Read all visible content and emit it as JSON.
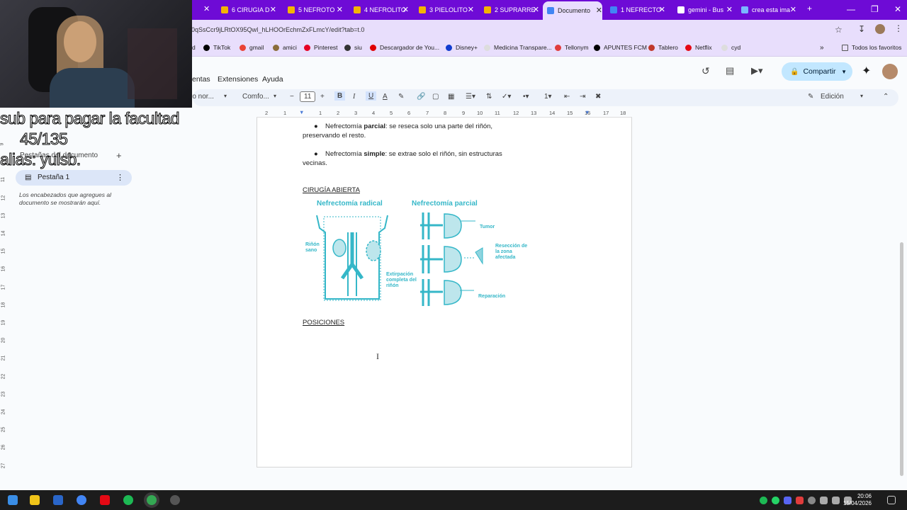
{
  "browser": {
    "tabs": [
      {
        "label": "6 CIRUGIA D",
        "color": "#f4b400"
      },
      {
        "label": "5 NEFROTO",
        "color": "#f4b400"
      },
      {
        "label": "4 NEFROLITO",
        "color": "#f4b400"
      },
      {
        "label": "3 PIELOLITO",
        "color": "#f4b400"
      },
      {
        "label": "2 SUPRARRE",
        "color": "#f4b400"
      },
      {
        "label": "Documento",
        "color": "#4285f4"
      },
      {
        "label": "1 NEFRECTO",
        "color": "#4285f4"
      },
      {
        "label": "gemini - Bus",
        "color": "#ffffff"
      },
      {
        "label": "crea esta ima",
        "color": "#7ab7ff"
      }
    ],
    "new_tab": "+",
    "url": "0qSsCcr9jLRtOX95QwI_hLHOOrEchmZxFLmcY/edit?tab=t.0",
    "bookmarks": [
      {
        "label": "d",
        "color": "#ffffff"
      },
      {
        "label": "TikTok",
        "color": "#000000"
      },
      {
        "label": "gmail",
        "color": "#ea4335"
      },
      {
        "label": "amici",
        "color": "#8a6d3b"
      },
      {
        "label": "Pinterest",
        "color": "#e60023"
      },
      {
        "label": "siu",
        "color": "#333333"
      },
      {
        "label": "Descargador de You...",
        "color": "#e00000"
      },
      {
        "label": "Disney+",
        "color": "#113ccf"
      },
      {
        "label": "Medicina Transpare...",
        "color": "#dddddd"
      },
      {
        "label": "Tellonym",
        "color": "#e03c3c"
      },
      {
        "label": "APUNTES FCM",
        "color": "#000000"
      },
      {
        "label": "Tablero",
        "color": "#c0392b"
      },
      {
        "label": "Netflix",
        "color": "#e50914"
      },
      {
        "label": "cyd",
        "color": "#dddddd"
      }
    ],
    "all_favorites": "Todos los favoritos"
  },
  "docs": {
    "menus": [
      "entas",
      "Extensiones",
      "Ayuda"
    ],
    "share_label": "Compartir",
    "mode_label": "Edición",
    "toolbar": {
      "style": "ro nor...",
      "font": "Comfo...",
      "size": "11"
    },
    "ruler": [
      "2",
      "1",
      "1",
      "2",
      "3",
      "4",
      "5",
      "6",
      "7",
      "8",
      "9",
      "10",
      "11",
      "12",
      "13",
      "14",
      "15",
      "16",
      "17",
      "18"
    ],
    "vruler": [
      "9",
      "10",
      "11",
      "12",
      "13",
      "14",
      "15",
      "16",
      "17",
      "18",
      "19",
      "20",
      "21",
      "22",
      "23",
      "24",
      "25",
      "26",
      "27"
    ],
    "sidebar": {
      "header": "Pestañas del documento",
      "tab_label": "Pestaña 1",
      "hint": "Los encabezados que agregues al documento se mostrarán aquí."
    },
    "body": {
      "b1_pre": "Nefrectomía ",
      "b1_bold": "parcial",
      "b1_post": ": se reseca solo una parte del riñón,",
      "b1_cont": "preservando el resto.",
      "b2_pre": "Nefrectomía ",
      "b2_bold": "simple",
      "b2_post": ": se extrae solo el riñón, sin estructuras",
      "b2_cont": "vecinas.",
      "heading1": "CIRUGÍA ABIERTA",
      "heading2": "POSICIONES"
    },
    "figure": {
      "title_left": "Nefrectomía radical",
      "title_right": "Nefrectomía parcial",
      "label_healthy": "Riñón sano",
      "label_extirp": "Extirpación completa del riñón",
      "label_tumor": "Tumor",
      "label_resec": "Resección de la zona afectada",
      "label_rep": "Reparación",
      "color": "#35b7c8"
    }
  },
  "overlay": {
    "line1": "sub para pagar la facultad",
    "line2": "45/135",
    "line3": "alias: yulsb."
  },
  "taskbar": {
    "time": "20:06",
    "date": "15/04/2026"
  }
}
